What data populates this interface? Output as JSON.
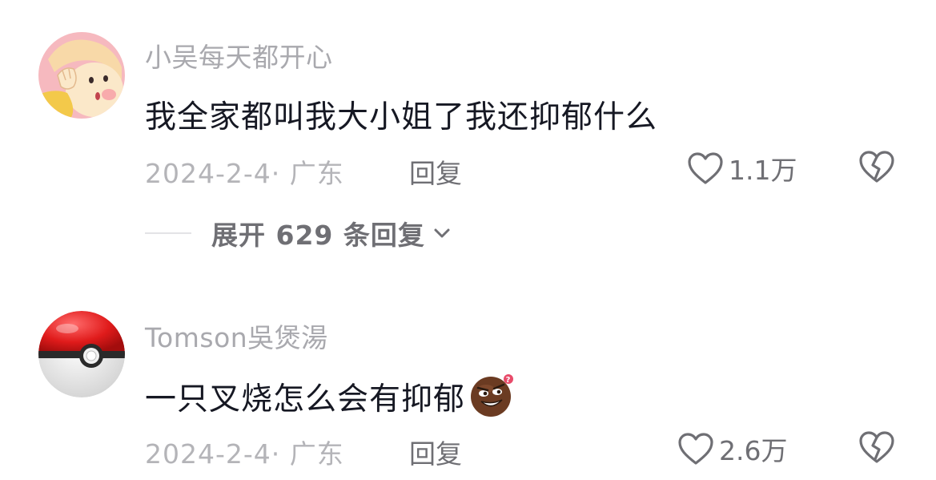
{
  "comments": [
    {
      "username": "小吴每天都开心",
      "text": "我全家都叫我大小姐了我还抑郁什么",
      "meta": "2024-2-4· 广东",
      "reply_label": "回复",
      "likes": "1.1万",
      "replies_toggle": "展开 629 条回复",
      "avatar_icon": "cartoon-girl-avatar"
    },
    {
      "username": "Tomson吳煲湯",
      "text": "一只叉烧怎么会有抑郁",
      "meta": "2024-2-4· 广东",
      "reply_label": "回复",
      "likes": "2.6万",
      "avatar_icon": "pokeball-avatar",
      "emoji_icon": "smirking-brown-emoji"
    }
  ],
  "colors": {
    "primary_text": "#161823",
    "secondary_text": "#a9a9ae",
    "action_text": "#6f6f74"
  }
}
